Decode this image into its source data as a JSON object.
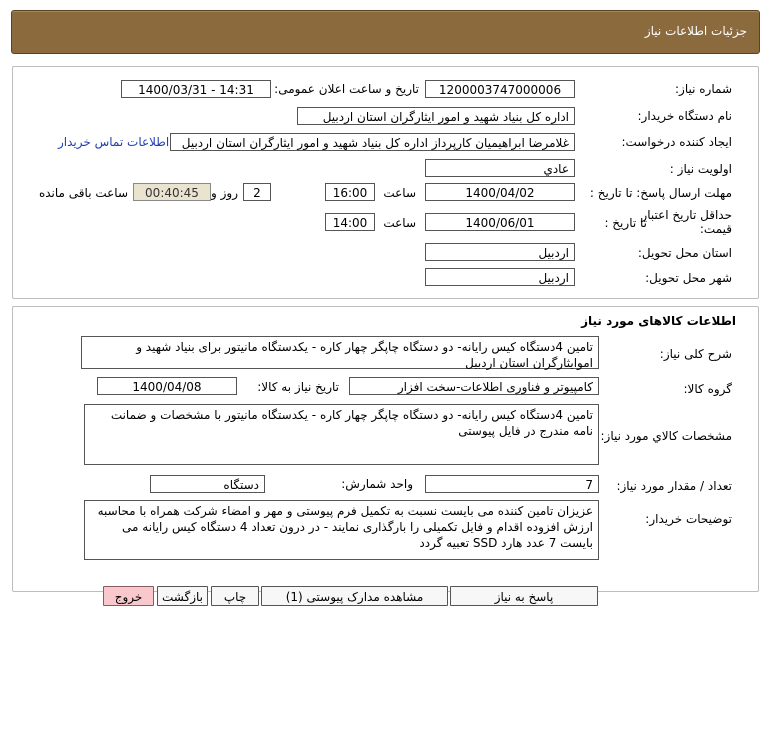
{
  "header": {
    "title": "جزئیات اطلاعات نیاز"
  },
  "info": {
    "need_number_label": "شماره نیاز:",
    "need_number": "1200003747000006",
    "announce_label": "تاریخ و ساعت اعلان عمومی:",
    "announce_value": "1400/03/31 - 14:31",
    "buyer_label": "نام دستگاه خریدار:",
    "buyer_value": "اداره کل بنیاد شهید و امور ایثارگران استان اردبیل",
    "requester_label": "ایجاد کننده درخواست:",
    "requester_value": "غلامرضا  ابراهیمیان  کارپرداز اداره کل بنیاد شهید و امور ایثارگران استان اردبیل",
    "contact_link": "اطلاعات تماس خریدار",
    "priority_label": "اولویت نیاز :",
    "priority_value": "عادي",
    "deadline_label": "مهلت ارسال پاسخ:  تا تاریخ :",
    "deadline_date": "1400/04/02",
    "hour_label": "ساعت",
    "deadline_time": "16:00",
    "days_value": "2",
    "days_label": "روز و",
    "remaining_time": "00:40:45",
    "remaining_label": "ساعت باقی مانده",
    "validity_label_1": "حداقل تاریخ اعتبار",
    "validity_label_2": "قیمت:",
    "validity_to_label": "تا تاریخ :",
    "validity_date": "1400/06/01",
    "validity_hour_label": "ساعت",
    "validity_time": "14:00",
    "province_label": "استان محل تحویل:",
    "province_value": "اردبیل",
    "city_label": "شهر محل تحویل:",
    "city_value": "اردبیل"
  },
  "goods": {
    "section_title": "اطلاعات کالاهای مورد نیاز",
    "summary_label": "شرح کلی نیاز:",
    "summary_value": "تامین 4دستگاه کیس رایانه- دو دستگاه چاپگر چهار کاره - یکدستگاه مانیتور برای بنیاد شهید و اموایثارگران استان اردبیل",
    "group_label": "گروه کالا:",
    "group_value": "کامپیوتر و فناوری اطلاعات-سخت افزار",
    "need_date_label": "تاریخ نیاز به کالا:",
    "need_date_value": "1400/04/08",
    "spec_label": "مشخصات کالاي مورد نياز:",
    "spec_value": "تامین 4دستگاه کیس رایانه- دو دستگاه چاپگر چهار کاره - یکدستگاه مانیتور با مشخصات و ضمانت نامه مندرج در فایل پیوستی",
    "qty_label": "تعداد / مقدار مورد نیاز:",
    "qty_value": "7",
    "unit_label": "واحد شمارش:",
    "unit_value": "دستگاه",
    "notes_label": "توضیحات خریدار:",
    "notes_value": "عزیزان تامین کننده می بایست نسبت به تکمیل فرم پیوستی و مهر و امضاء شرکت همراه با محاسبه ارزش افزوده اقدام و فایل تکمیلی را بارگذاری نمایند - در درون تعداد 4 دستگاه کیس رایانه می بایست 7 عدد هارد SSD تعبیه گردد"
  },
  "buttons": {
    "reply": "پاسخ به نیاز",
    "attachments": "مشاهده مدارک پیوستی (1)",
    "print": "چاپ",
    "back": "بازگشت",
    "exit": "خروج"
  }
}
